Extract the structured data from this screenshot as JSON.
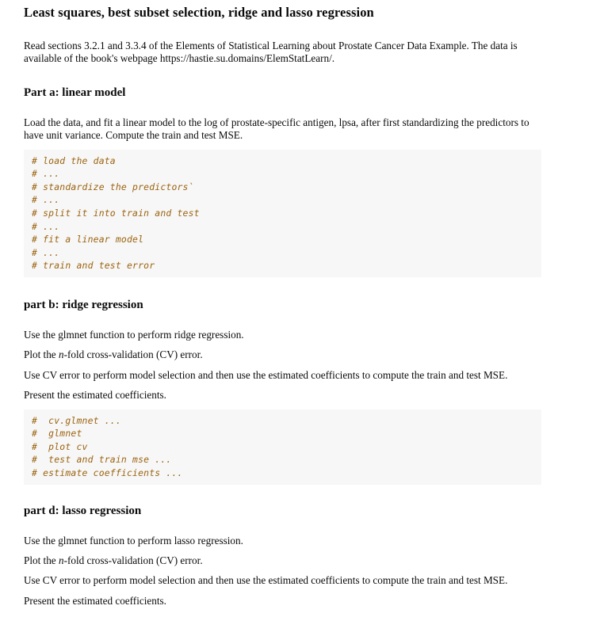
{
  "document": {
    "title": "Least squares, best subset selection, ridge and lasso regression",
    "intro": "Read sections 3.2.1 and 3.3.4 of the Elements of Statistical Learning about Prostate Cancer Data Example. The data is available of the book's webpage https://hastie.su.domains/ElemStatLearn/."
  },
  "part_a": {
    "heading": "Part a: linear model",
    "paragraph": "Load the data, and fit a linear model to the log of prostate-specific antigen, lpsa, after first standardizing the predictors to have unit variance. Compute the train and test MSE.",
    "code": "# load the data\n# ...\n# standardize the predictors`\n# ...\n# split it into train and test\n# ...\n# fit a linear model\n# ...\n# train and test error"
  },
  "part_b": {
    "heading": "part b: ridge regression",
    "p1": "Use the glmnet function to perform ridge regression.",
    "p2_before": "Plot the ",
    "p2_var": "n",
    "p2_after": "-fold cross-validation (CV) error.",
    "p3": "Use CV error to perform model selection and then use the estimated coefficients to compute the train and test MSE.",
    "p4": "Present the estimated coefficients.",
    "code": "#  cv.glmnet ...\n#  glmnet\n#  plot cv\n#  test and train mse ...\n# estimate coefficients ..."
  },
  "part_d": {
    "heading": "part d: lasso regression",
    "p1": "Use the glmnet function to perform lasso regression.",
    "p2_before": "Plot the ",
    "p2_var": "n",
    "p2_after": "-fold cross-validation (CV) error.",
    "p3": "Use CV error to perform model selection and then use the estimated coefficients to compute the train and test MSE.",
    "p4": "Present the estimated coefficients."
  },
  "colors": {
    "code_text": "#9c6410",
    "code_background": "#f7f7f7",
    "body_text": "#0a0a0a",
    "page_background": "#ffffff"
  }
}
